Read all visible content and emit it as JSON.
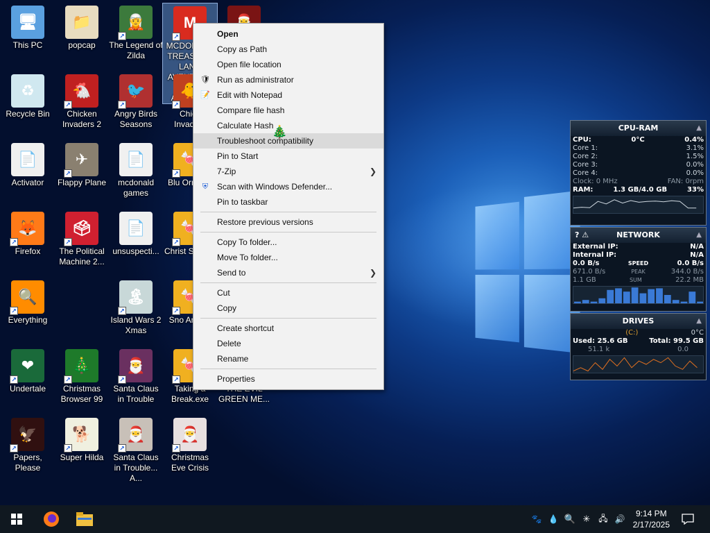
{
  "desktop": {
    "icons": [
      {
        "label": "This PC",
        "glyph": "🖥",
        "color": "#5aa0e0"
      },
      {
        "label": "popcap",
        "glyph": "📁",
        "color": "#e8dcc0"
      },
      {
        "label": "The Legend of Zilda",
        "glyph": "🧝",
        "color": "#3c7a3c"
      },
      {
        "label": "MCDONALD TREASURE LAND AVENTURE FOR AMERICA",
        "glyph": "M",
        "color": "#d92b1f"
      },
      {
        "label": "",
        "glyph": "🎅",
        "color": "#7a1414"
      },
      {
        "label": "Recycle Bin",
        "glyph": "♻",
        "color": "#d0e8f0"
      },
      {
        "label": "Chicken Invaders 2",
        "glyph": "🐔",
        "color": "#c02020"
      },
      {
        "label": "Angry Birds Seasons",
        "glyph": "🐦",
        "color": "#b03030"
      },
      {
        "label": "Chick Invaders",
        "glyph": "🐥",
        "color": "#c04020"
      },
      {
        "label": "Activator",
        "glyph": "📄",
        "color": "#f0f0f0"
      },
      {
        "label": "Flappy Plane",
        "glyph": "✈",
        "color": "#8a8070"
      },
      {
        "label": "mcdonald games",
        "glyph": "📄",
        "color": "#f0f0f0"
      },
      {
        "label": "Blu Orname",
        "glyph": "🍬",
        "color": "#f0b020"
      },
      {
        "label": "Firefox",
        "glyph": "🦊",
        "color": "#ff7a18"
      },
      {
        "label": "The Political Machine 2...",
        "glyph": "🗳",
        "color": "#d02030"
      },
      {
        "label": "unsuspecti...",
        "glyph": "📄",
        "color": "#f0f0f0"
      },
      {
        "label": "Christ Sweets",
        "glyph": "🍬",
        "color": "#f0b020"
      },
      {
        "label": "Everything",
        "glyph": "🔍",
        "color": "#ff8c00"
      },
      {
        "label": "Island Wars 2 Xmas",
        "glyph": "🏝",
        "color": "#c8d8d8"
      },
      {
        "label": "Sno Animal",
        "glyph": "🍬",
        "color": "#f0b020"
      },
      {
        "label": "Undertale",
        "glyph": "❤",
        "color": "#1a6a3a"
      },
      {
        "label": "Christmas Browser 99",
        "glyph": "🎄",
        "color": "#1e7a2a"
      },
      {
        "label": "Santa Claus in Trouble",
        "glyph": "🎅",
        "color": "#6a3060"
      },
      {
        "label": "Taking a Break.exe",
        "glyph": "🍬",
        "color": "#f0b020"
      },
      {
        "label": "THE EVIL GREEN ME...",
        "glyph": "",
        "color": "transparent"
      },
      {
        "label": "Papers, Please",
        "glyph": "🦅",
        "color": "#301010"
      },
      {
        "label": "Super Hilda",
        "glyph": "🐕",
        "color": "#f0f0e0"
      },
      {
        "label": "Santa Claus in Trouble... A...",
        "glyph": "🎅",
        "color": "#c8c0b8"
      },
      {
        "label": "Christmas Eve Crisis",
        "glyph": "🎅",
        "color": "#e8e0e0"
      }
    ]
  },
  "context_menu": {
    "items": [
      {
        "label": "Open"
      },
      {
        "label": "Copy as Path"
      },
      {
        "label": "Open file location"
      },
      {
        "label": "Run as administrator",
        "icon": "🛡"
      },
      {
        "label": "Edit with Notepad",
        "icon": "📝"
      },
      {
        "label": "Compare file hash"
      },
      {
        "label": "Calculate Hash"
      },
      {
        "label": "Troubleshoot compatibility"
      },
      {
        "label": "Pin to Start"
      },
      {
        "label": "7-Zip"
      },
      {
        "label": "Scan with Windows Defender...",
        "icon": "⛨"
      },
      {
        "label": "Pin to taskbar"
      },
      {
        "label": "Restore previous versions"
      },
      {
        "label": "Copy To folder..."
      },
      {
        "label": "Move To folder..."
      },
      {
        "label": "Send to"
      },
      {
        "label": "Cut"
      },
      {
        "label": "Copy"
      },
      {
        "label": "Create shortcut"
      },
      {
        "label": "Delete"
      },
      {
        "label": "Rename"
      },
      {
        "label": "Properties"
      }
    ],
    "cursor_glyph": "🎄",
    "arrow_glyph": "❯"
  },
  "gadgets": {
    "cpu": {
      "title": "CPU-RAM",
      "cpu_label": "CPU:",
      "cpu_temp": "0°C",
      "cpu_pct": "0.4%",
      "cores": [
        {
          "label": "Core 1:",
          "val": "3.1%"
        },
        {
          "label": "Core 2:",
          "val": "1.5%"
        },
        {
          "label": "Core 3:",
          "val": "0.0%"
        },
        {
          "label": "Core 4:",
          "val": "0.0%"
        }
      ],
      "clock": "Clock: 0 MHz",
      "fan": "FAN: 0rpm",
      "ram_label": "RAM:",
      "ram_val": "1.3 GB/4.0 GB",
      "ram_pct": "33%",
      "ram_history": [
        0.3,
        0.35,
        0.32,
        0.7,
        0.55,
        0.8,
        0.6,
        0.75,
        0.65,
        0.7,
        0.72,
        0.68,
        0.74,
        0.7,
        0.3,
        0.3
      ]
    },
    "network": {
      "title": "NETWORK",
      "ext_label": "External IP:",
      "ext_val": "N/A",
      "int_label": "Internal IP:",
      "int_val": "N/A",
      "rows": [
        {
          "left": "0.0 B/s",
          "mid": "SPEED",
          "right": "0.0 B/s"
        },
        {
          "left": "671.0 B/s",
          "mid": "PEAK",
          "right": "344.0 B/s"
        },
        {
          "left": "1.1 GB",
          "mid": "SUM",
          "right": "22.2 MB"
        }
      ],
      "history": [
        0.1,
        0.2,
        0.1,
        0.3,
        0.8,
        0.9,
        0.7,
        0.95,
        0.6,
        0.85,
        0.9,
        0.5,
        0.2,
        0.1,
        0.7,
        0.1
      ]
    },
    "drives": {
      "title": "DRIVES",
      "drive": "(C:)",
      "temp": "0°C",
      "used": "Used: 25.6 GB",
      "total": "Total: 99.5 GB",
      "read": "51.1 k",
      "write": "0.0",
      "history": [
        0.1,
        0.3,
        0.1,
        0.6,
        0.2,
        0.8,
        0.4,
        0.9,
        0.3,
        0.7,
        0.5,
        0.8,
        0.6,
        0.9,
        0.4,
        0.2,
        0.7,
        0.3
      ]
    }
  },
  "taskbar": {
    "time": "9:14 PM",
    "date": "2/17/2025"
  },
  "colors": {
    "accent": "#1a5bd6",
    "gadget_graph": "#e07020",
    "net_graph": "#3a7ad6"
  }
}
